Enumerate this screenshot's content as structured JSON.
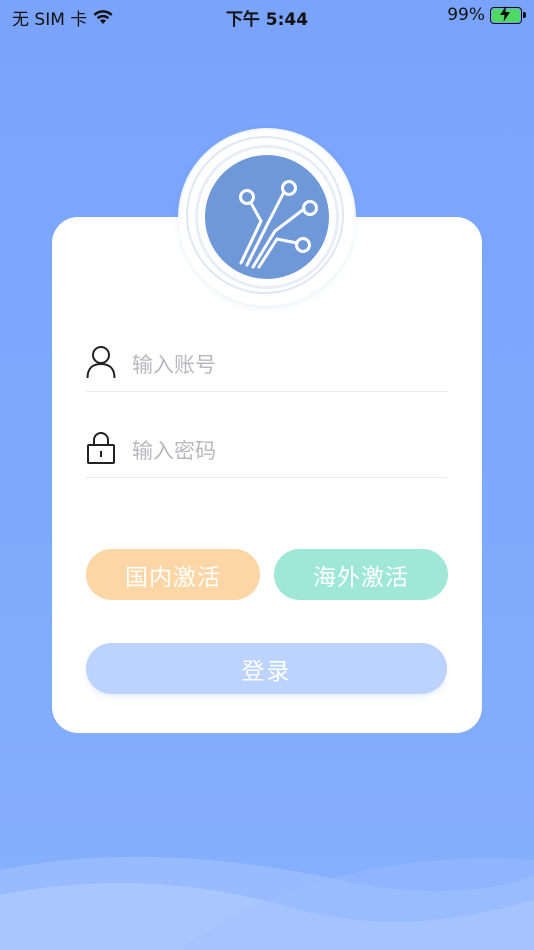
{
  "status": {
    "carrier": "无 SIM 卡",
    "time": "下午 5:44",
    "battery": "99%"
  },
  "login": {
    "account_placeholder": "输入账号",
    "password_placeholder": "输入密码",
    "domestic_activate": "国内激活",
    "overseas_activate": "海外激活",
    "login_button": "登录"
  },
  "icons": {
    "logo": "circuit-logo-icon",
    "account": "user-icon",
    "password": "lock-icon"
  },
  "colors": {
    "background": "#7aa4fb",
    "domestic": "#fdd6a6",
    "overseas": "#9fe7d6",
    "login": "#bdd3ff",
    "logo": "#6f98d8"
  }
}
